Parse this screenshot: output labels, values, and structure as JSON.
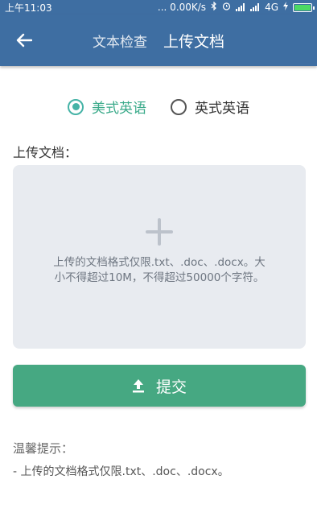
{
  "status_bar": {
    "time": "上午11:03",
    "net": "... 0.00K/s",
    "network_type": "4G",
    "icons": [
      "bluetooth-icon",
      "alarm-icon",
      "signal-icon",
      "battery-icon"
    ]
  },
  "header": {
    "tabs": [
      {
        "label": "文本检查",
        "active": false
      },
      {
        "label": "上传文档",
        "active": true
      }
    ]
  },
  "language": {
    "options": [
      {
        "label": "美式英语",
        "checked": true
      },
      {
        "label": "英式英语",
        "checked": false
      }
    ]
  },
  "upload": {
    "label": "上传文档：",
    "hint": "上传的文档格式仅限.txt、.doc、.docx。大小不得超过10M，不得超过50000个字符。"
  },
  "submit": {
    "label": "提交"
  },
  "tips": {
    "title": "温馨提示：",
    "text": "- 上传的文档格式仅限.txt、.doc、.docx。"
  },
  "colors": {
    "primary": "#3e6ea2",
    "accent": "#46a882",
    "radio": "#45b3a6"
  }
}
